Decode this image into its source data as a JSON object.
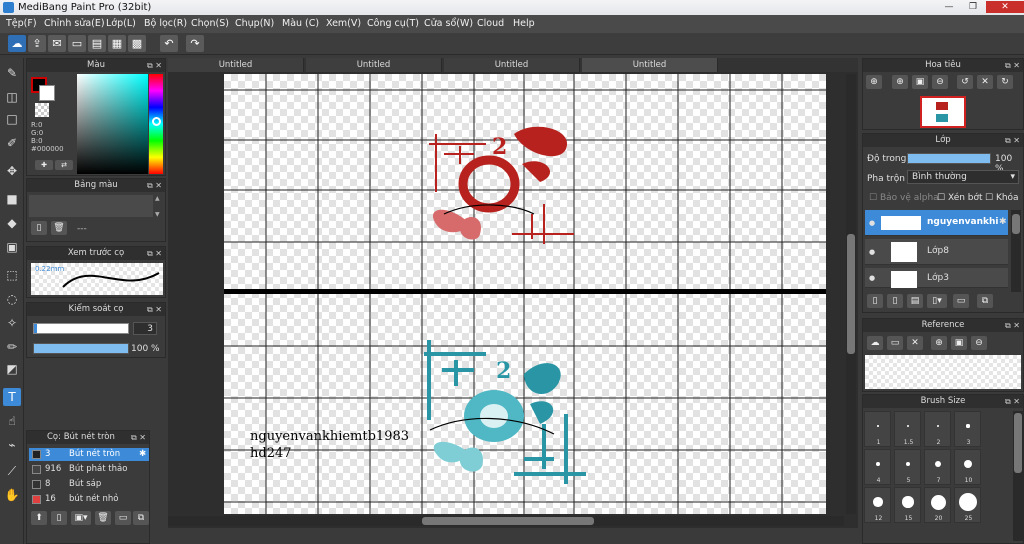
{
  "title": "MediBang Paint Pro (32bit)",
  "menu": [
    "Tệp(F)",
    "Chỉnh sửa(E)",
    "Lớp(L)",
    "Bộ lọc(R)",
    "Chọn(S)",
    "Chụp(N)",
    "Màu (C)",
    "Xem(V)",
    "Công cụ(T)",
    "Cửa sổ(W)",
    "Cloud",
    "Help"
  ],
  "panels": {
    "color": {
      "title": "Màu",
      "r": "R:0",
      "g": "G:0",
      "b": "B:0",
      "hex": "#000000"
    },
    "palette": {
      "title": "Bảng màu",
      "value": "---"
    },
    "brush_preview": {
      "title": "Xem trước cọ",
      "size": "0.22mm"
    },
    "brush_control": {
      "title": "Kiểm soát cọ",
      "size": "3",
      "opacity": "100 %"
    },
    "brush_list": {
      "title": "Cọ: Bút nét tròn",
      "items": [
        {
          "size": "3",
          "name": "Bút nét tròn",
          "color": "#222222"
        },
        {
          "size": "916",
          "name": "Bút phát thảo",
          "color": "#444444"
        },
        {
          "size": "8",
          "name": "Bút sáp",
          "color": "#333333"
        },
        {
          "size": "16",
          "name": "bút nét nhỏ",
          "color": "#e04040"
        }
      ]
    },
    "navigator": {
      "title": "Hoa tiêu"
    },
    "layer": {
      "title": "Lớp",
      "opacity_label": "Độ trong",
      "opacity": "100 %",
      "blend_label": "Pha trộn",
      "blend": "Bình thường",
      "protect_alpha": "Bảo vệ alpha",
      "clipping": "Xén bớt",
      "lock": "Khóa",
      "layers": [
        "nguyenvankhi",
        "Lớp8",
        "Lớp3"
      ]
    },
    "reference": {
      "title": "Reference"
    },
    "brush_size": {
      "title": "Brush Size",
      "labels": [
        "1",
        "1.5",
        "2",
        "3",
        "4",
        "5",
        "7",
        "10",
        "12",
        "15",
        "20",
        "25"
      ]
    }
  },
  "tabs": [
    "Untitled",
    "Untitled",
    "Untitled",
    "Untitled"
  ],
  "canvas": {
    "text1": "nguyenvankhiemtb1983",
    "text2": "hd247"
  },
  "colors": {
    "accent": "#3d8ad8",
    "red_logo": "#b8221e",
    "teal_logo": "#2a96a5"
  }
}
